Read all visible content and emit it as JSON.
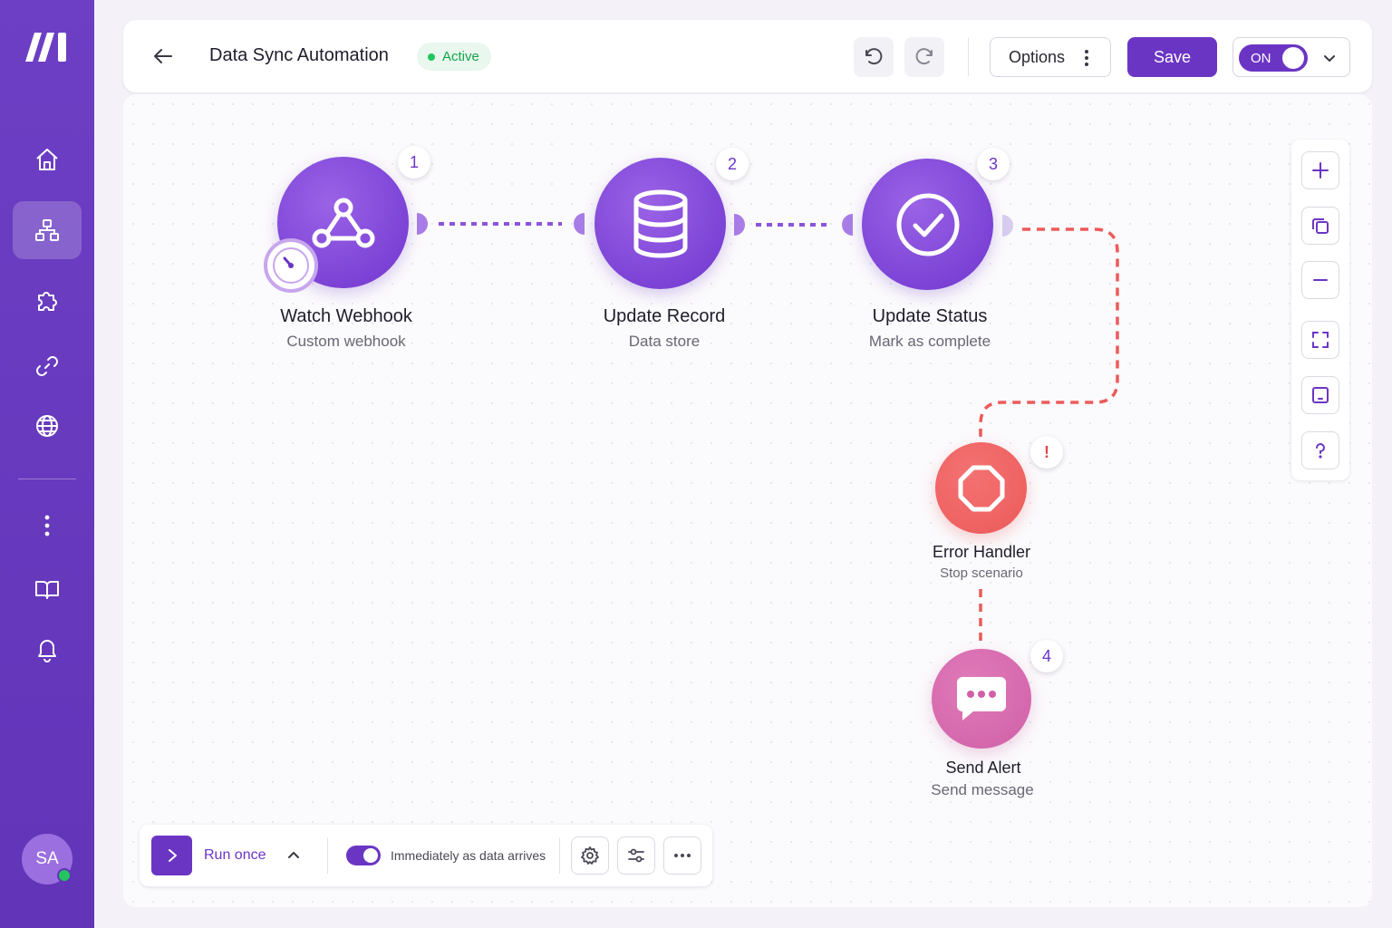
{
  "header": {
    "title": "Data Sync Automation",
    "status": "Active",
    "options_label": "Options",
    "save_label": "Save",
    "toggle_label": "ON"
  },
  "sidebar": {
    "items": [
      {
        "icon": "home-icon"
      },
      {
        "icon": "scenarios-icon",
        "active": true
      },
      {
        "icon": "puzzle-icon"
      },
      {
        "icon": "link-icon"
      },
      {
        "icon": "globe-icon"
      },
      {
        "icon": "more-vertical-icon"
      },
      {
        "icon": "book-icon"
      },
      {
        "icon": "bell-icon"
      }
    ],
    "avatar_initials": "SA",
    "online_status_color": "#22c55e"
  },
  "nodes": [
    {
      "number": "1",
      "title": "Watch Webhook",
      "subtitle": "Custom webhook",
      "icon": "webhook-icon",
      "color": "#7c43d6"
    },
    {
      "number": "2",
      "title": "Update Record",
      "subtitle": "Data store",
      "icon": "database-icon",
      "color": "#7c43d6"
    },
    {
      "number": "3",
      "title": "Update Status",
      "subtitle": "Mark as complete",
      "icon": "check-circle-icon",
      "color": "#7c43d6"
    },
    {
      "number": "!",
      "title": "Error Handler",
      "subtitle": "Stop scenario",
      "icon": "stop-octagon-icon",
      "color": "#ec5a5a"
    },
    {
      "number": "4",
      "title": "Send Alert",
      "subtitle": "Send message",
      "icon": "message-icon",
      "color": "#d060a8"
    }
  ],
  "canvas_tools": [
    {
      "icon": "plus-icon"
    },
    {
      "icon": "copy-icon"
    },
    {
      "icon": "minus-icon"
    },
    {
      "icon": "fit-screen-icon"
    },
    {
      "icon": "minimap-icon"
    },
    {
      "icon": "help-icon"
    }
  ],
  "bottom_bar": {
    "run_label": "Run once",
    "schedule_label": "Immediately as data arrives",
    "schedule_enabled": true
  },
  "colors": {
    "brand": "#6b35c4",
    "error": "#ec5a5a",
    "alert": "#d060a8",
    "active": "#16a34a"
  }
}
